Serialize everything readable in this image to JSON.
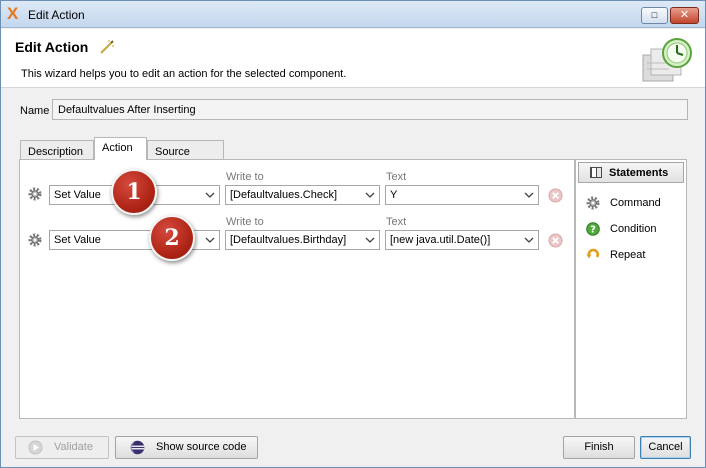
{
  "window": {
    "title": "Edit Action",
    "restore_glyph": "□",
    "close_glyph": "✕"
  },
  "header": {
    "title": "Edit Action",
    "subtitle": "This wizard helps you to edit an action for the selected component."
  },
  "name": {
    "label": "Name",
    "value": "Defaultvalues After Inserting"
  },
  "tabs": [
    {
      "label": "Description",
      "active": false
    },
    {
      "label": "Action",
      "active": true
    },
    {
      "label": "Source code",
      "active": false
    }
  ],
  "rows": [
    {
      "command": "Set Value",
      "write_to_label": "Write to",
      "write_to": "[Defaultvalues.Check]",
      "text_label": "Text",
      "text": "Y",
      "badge": "1"
    },
    {
      "command": "Set Value",
      "write_to_label": "Write to",
      "write_to": "[Defaultvalues.Birthday]",
      "text_label": "Text",
      "text": "[new java.util.Date()]",
      "badge": "2"
    }
  ],
  "statements": {
    "header": "Statements",
    "items": [
      {
        "label": "Command",
        "icon": "gear-icon"
      },
      {
        "label": "Condition",
        "icon": "question-icon"
      },
      {
        "label": "Repeat",
        "icon": "repeat-icon"
      }
    ]
  },
  "buttons": {
    "validate": "Validate",
    "show_source": "Show source code",
    "finish": "Finish",
    "cancel": "Cancel"
  },
  "colors": {
    "badge_red": "#ae2415",
    "title_bar": "#c4d7ee",
    "default_button_border": "#3c7fb1"
  }
}
